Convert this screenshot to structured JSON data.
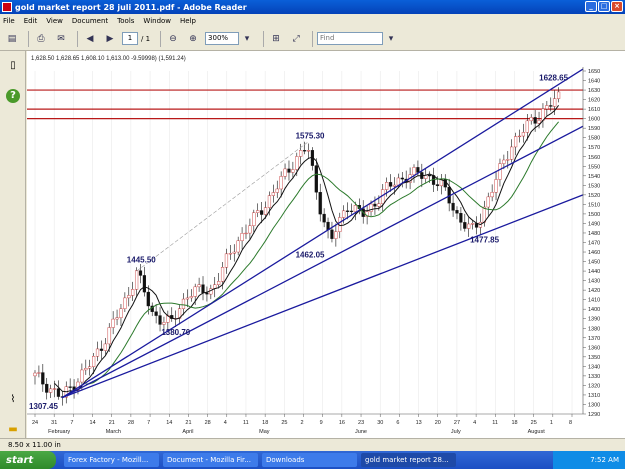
{
  "window": {
    "title": "gold market report 28 juli 2011.pdf - Adobe Reader"
  },
  "menu": [
    "File",
    "Edit",
    "View",
    "Document",
    "Tools",
    "Window",
    "Help"
  ],
  "toolbar": {
    "page_current": "1",
    "page_total": "/ 1",
    "zoom": "300%",
    "find_placeholder": "Find"
  },
  "chart_header": "1,628.50  1,628.65  1,608.10  1,613.00  -9.59998)      (1,591.24)",
  "chart_data": {
    "type": "candlestick",
    "y_ticks": [
      "1650",
      "1640",
      "1630",
      "1620",
      "1610",
      "1600",
      "1590",
      "1580",
      "1570",
      "1560",
      "1550",
      "1540",
      "1530",
      "1520",
      "1510",
      "1500",
      "1490",
      "1480",
      "1470",
      "1460",
      "1450",
      "1440",
      "1430",
      "1420",
      "1410",
      "1400",
      "1390",
      "1380",
      "1370",
      "1360",
      "1350",
      "1340",
      "1330",
      "1320",
      "1310",
      "1300",
      "1290"
    ],
    "ylim": [
      1290,
      1650
    ],
    "x_ticks": [
      "24",
      "31",
      "7",
      "14",
      "21",
      "28",
      "7",
      "14",
      "21",
      "28",
      "4",
      "11",
      "18",
      "25",
      "2",
      "9",
      "16",
      "23",
      "30",
      "6",
      "13",
      "20",
      "27",
      "4",
      "11",
      "18",
      "25",
      "1",
      "8"
    ],
    "month_labels": [
      "February",
      "March",
      "April",
      "May",
      "June",
      "July",
      "August"
    ],
    "annotations": [
      {
        "text": "1307.45",
        "value": 1307.45
      },
      {
        "text": "1445.50",
        "value": 1445.5
      },
      {
        "text": "1380.70",
        "value": 1380.7
      },
      {
        "text": "1575.30",
        "value": 1575.3
      },
      {
        "text": "1462.05",
        "value": 1462.05
      },
      {
        "text": "1477.85",
        "value": 1477.85
      },
      {
        "text": "1628.65",
        "value": 1628.65
      }
    ],
    "horizontal_levels": [
      1630,
      1610,
      1600
    ],
    "colors": {
      "trendline": "#1a1a9e",
      "level": "#b81818",
      "ma_short": "#111111",
      "ma_long": "#2c7a2c",
      "bull": "#ffffff",
      "bear": "#111111"
    }
  },
  "status": {
    "page_size": "8.50 x 11.00 in"
  },
  "taskbar": {
    "start": "start",
    "tasks": [
      "Forex Factory - Mozill...",
      "Document - Mozilla Fir...",
      "Downloads",
      "gold market report 28..."
    ],
    "clock": "7:52 AM"
  }
}
